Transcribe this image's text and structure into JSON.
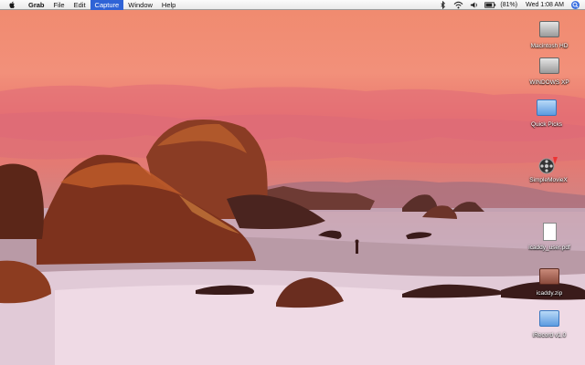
{
  "menubar": {
    "apple_icon": "apple-icon",
    "app_name": "Grab",
    "menus": [
      "File",
      "Edit",
      "Capture",
      "Window",
      "Help"
    ],
    "active_menu": "Capture",
    "status": {
      "battery_text": "(81%)",
      "clock": "Wed 1:08 AM"
    },
    "colors": {
      "highlight": "#2f63d6",
      "bar": "#efefef"
    }
  },
  "desktop": {
    "icons": [
      {
        "label": "Macintosh HD",
        "kind": "hard-drive-icon"
      },
      {
        "label": "WINDOWS XP",
        "kind": "hard-drive-icon"
      },
      {
        "label": "Quick Picks",
        "kind": "folder-icon"
      },
      {
        "label": "SimpleMovieX",
        "kind": "application-icon"
      },
      {
        "label": "icaddy_user.pdf",
        "kind": "pdf-document-icon"
      },
      {
        "label": "icaddy.zip",
        "kind": "zip-archive-icon"
      },
      {
        "label": "iRecord v1.0",
        "kind": "folder-icon"
      }
    ]
  }
}
